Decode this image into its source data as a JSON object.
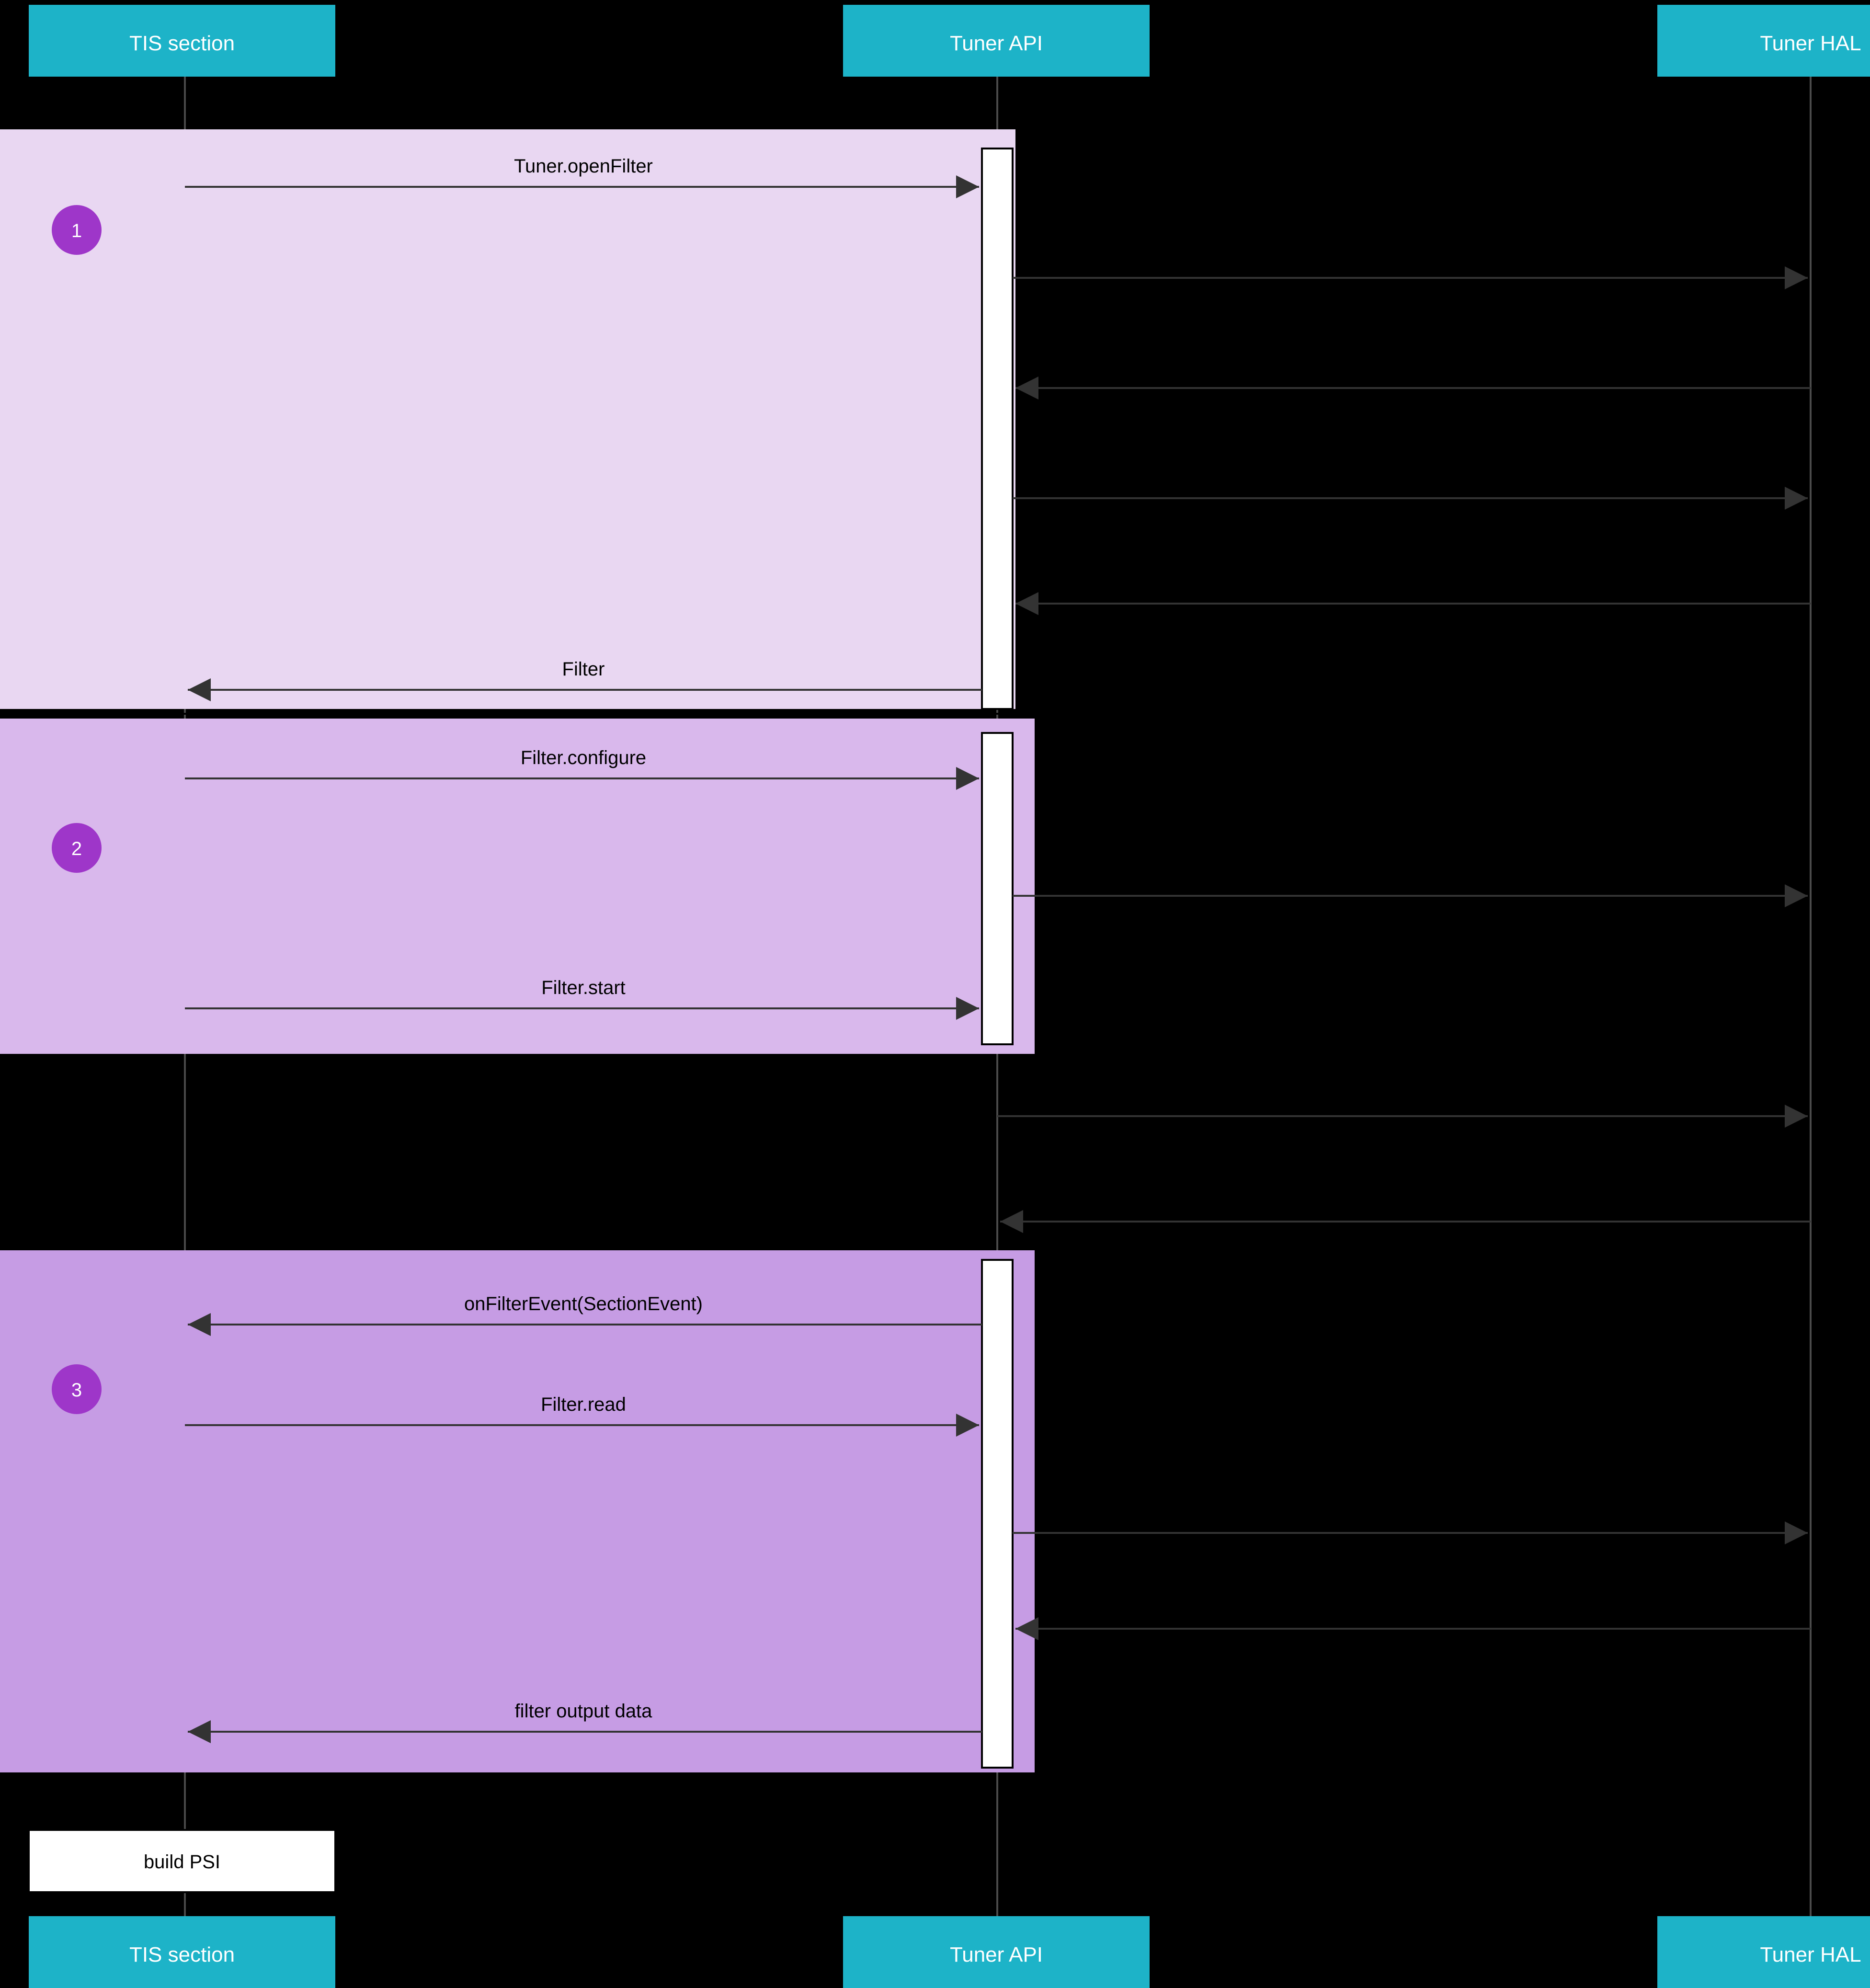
{
  "participants": {
    "p1": "TIS section",
    "p2": "Tuner API",
    "p3": "Tuner HAL"
  },
  "steps": {
    "s1": "1",
    "s2": "2",
    "s3": "3"
  },
  "messages": {
    "m1": "Tuner.openFilter",
    "m2": "Filter",
    "m3": "Filter.configure",
    "m4": "Filter.start",
    "m5": "onFilterEvent(SectionEvent)",
    "m6": "Filter.read",
    "m7": "filter output data"
  },
  "note": "build PSI"
}
